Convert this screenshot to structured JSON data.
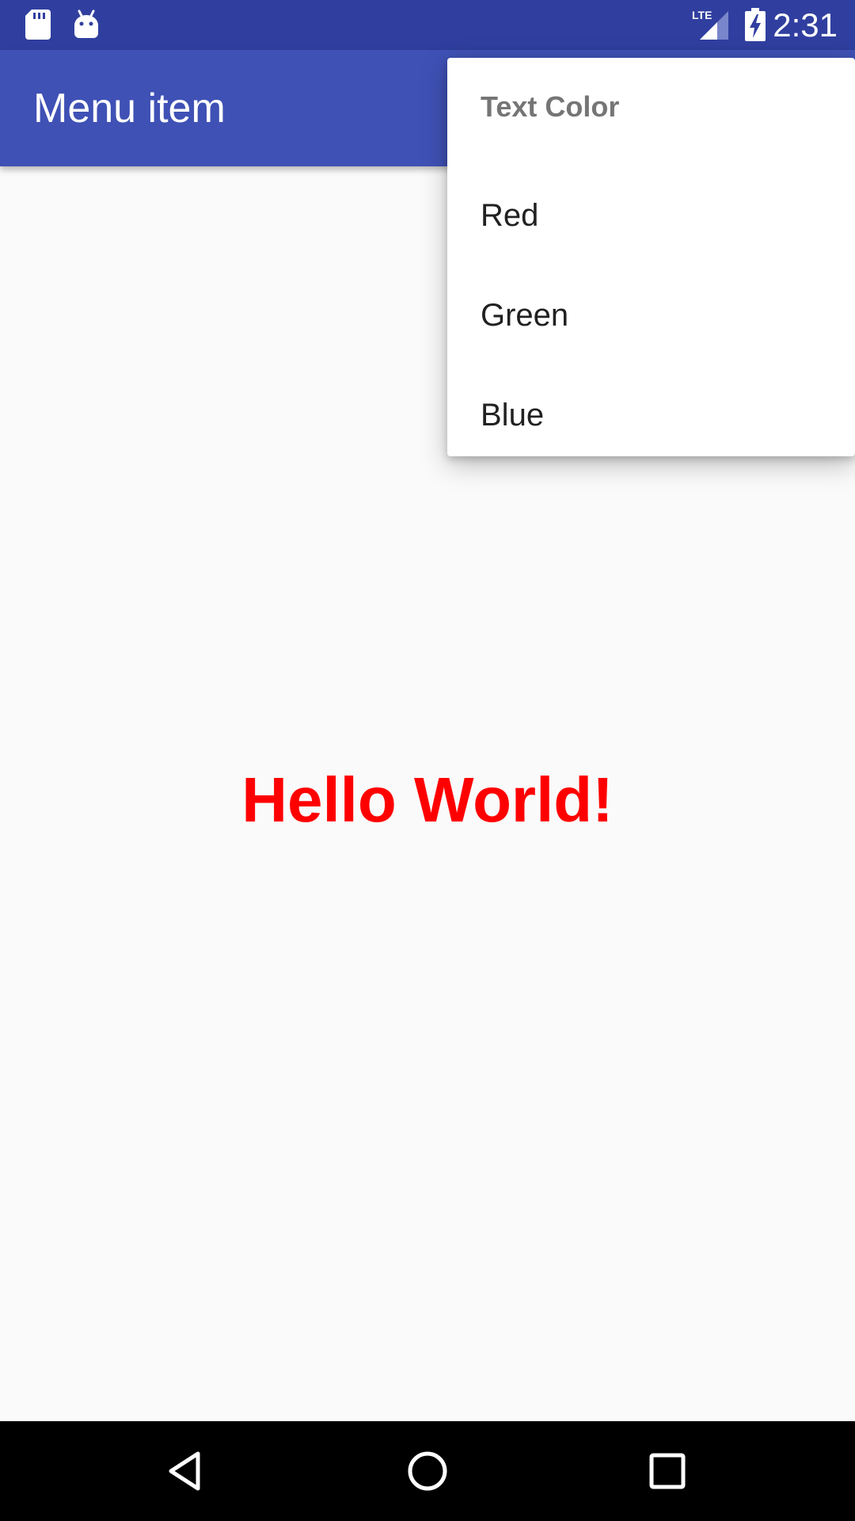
{
  "status_bar": {
    "time": "2:31",
    "icons": [
      "sd-card-icon",
      "android-debug-icon",
      "lte-signal-icon",
      "battery-charging-icon"
    ],
    "background": "#303f9f"
  },
  "app_bar": {
    "title": "Menu item",
    "background": "#3f51b5"
  },
  "content": {
    "text": "Hello World!",
    "text_color": "#ff0000"
  },
  "popup_menu": {
    "header": "Text Color",
    "items": [
      {
        "label": "Red"
      },
      {
        "label": "Green"
      },
      {
        "label": "Blue"
      }
    ]
  },
  "nav_bar": {
    "buttons": [
      "back-icon",
      "home-icon",
      "recents-icon"
    ]
  }
}
